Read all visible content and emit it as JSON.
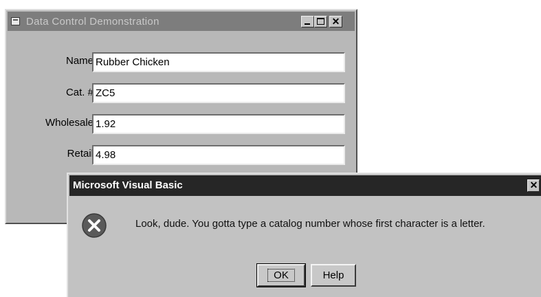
{
  "form_window": {
    "title": "Data Control Demonstration",
    "close_glyph": "✕",
    "fields": [
      {
        "label": "Name",
        "value": "Rubber Chicken"
      },
      {
        "label": "Cat. #",
        "value": "ZC5"
      },
      {
        "label": "Wholesale",
        "value": "1.92"
      },
      {
        "label": "Retail",
        "value": "4.98"
      }
    ]
  },
  "message_box": {
    "title": "Microsoft Visual Basic",
    "close_glyph": "✕",
    "icon": "error-x-icon",
    "message": "Look, dude. You gotta type a catalog number whose first character is a letter.",
    "ok_label": "OK",
    "help_label": "Help"
  },
  "colors": {
    "inactive_titlebar": "#7d7d7d",
    "active_titlebar": "#262626",
    "window_face": "#b8b8b8",
    "dialog_face": "#c2c2c2",
    "error_icon": "#5a5a5a"
  }
}
